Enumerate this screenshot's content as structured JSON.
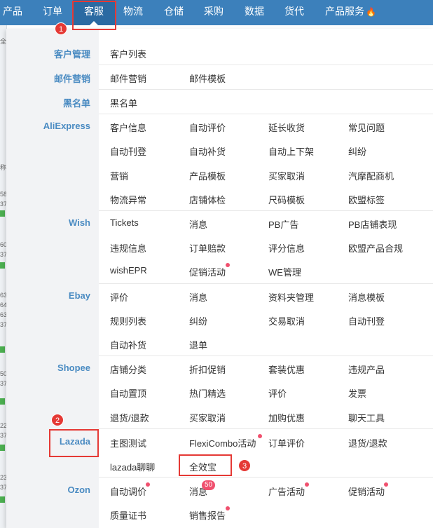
{
  "topnav": {
    "items": [
      {
        "label": "产品"
      },
      {
        "label": "订单"
      },
      {
        "label": "客服"
      },
      {
        "label": "物流"
      },
      {
        "label": "仓储"
      },
      {
        "label": "采购"
      },
      {
        "label": "数据"
      },
      {
        "label": "货代"
      },
      {
        "label": "产品服务"
      }
    ],
    "active_index": 2
  },
  "background": {
    "fragments": [
      "全",
      "称",
      "58",
      "37",
      "60",
      "37",
      "63",
      "64",
      "63",
      "37",
      "50",
      "37",
      "22",
      "37",
      "23",
      "37"
    ]
  },
  "sections": {
    "customer_mgmt": {
      "label": "客户管理",
      "items": [
        "客户列表"
      ]
    },
    "email_marketing": {
      "label": "邮件营销",
      "items": [
        "邮件营销",
        "邮件模板"
      ]
    },
    "blacklist": {
      "label": "黑名单",
      "items": [
        "黑名单"
      ]
    },
    "aliexpress": {
      "label": "AliExpress",
      "items": [
        "客户信息",
        "自动评价",
        "延长收货",
        "常见问题",
        "自动刊登",
        "自动补货",
        "自动上下架",
        "纠纷",
        "营销",
        "产品模板",
        "买家取消",
        "汽摩配商机",
        "物流异常",
        "店铺体检",
        "尺码模板",
        "欧盟标签"
      ]
    },
    "wish": {
      "label": "Wish",
      "items": [
        "Tickets",
        "消息",
        "PB广告",
        "PB店铺表现",
        "违规信息",
        "订单赔款",
        "评分信息",
        "欧盟产品合规",
        "wishEPR",
        "促销活动",
        "WE管理"
      ]
    },
    "ebay": {
      "label": "Ebay",
      "items": [
        "评价",
        "消息",
        "资料夹管理",
        "消息模板",
        "规则列表",
        "纠纷",
        "交易取消",
        "自动刊登",
        "自动补货",
        "退单"
      ]
    },
    "shopee": {
      "label": "Shopee",
      "items": [
        "店铺分类",
        "折扣促销",
        "套装优惠",
        "违规产品",
        "自动置顶",
        "热门精选",
        "评价",
        "发票",
        "退货/退款",
        "买家取消",
        "加购优惠",
        "聊天工具"
      ]
    },
    "lazada": {
      "label": "Lazada",
      "items": [
        "主图测试",
        "FlexiCombo活动",
        "订单评价",
        "退货/退款",
        "lazada聊聊",
        "全效宝"
      ]
    },
    "ozon": {
      "label": "Ozon",
      "items": [
        "自动调价",
        "消息",
        "广告活动",
        "促销活动",
        "质量证书",
        "销售报告"
      ],
      "message_badge": "50"
    }
  },
  "annotations": [
    "1",
    "2",
    "3"
  ],
  "colors": {
    "nav_bg": "#3c80bb",
    "accent": "#4a8bc2",
    "dot": "#f0506e",
    "annotation": "#e53935"
  }
}
